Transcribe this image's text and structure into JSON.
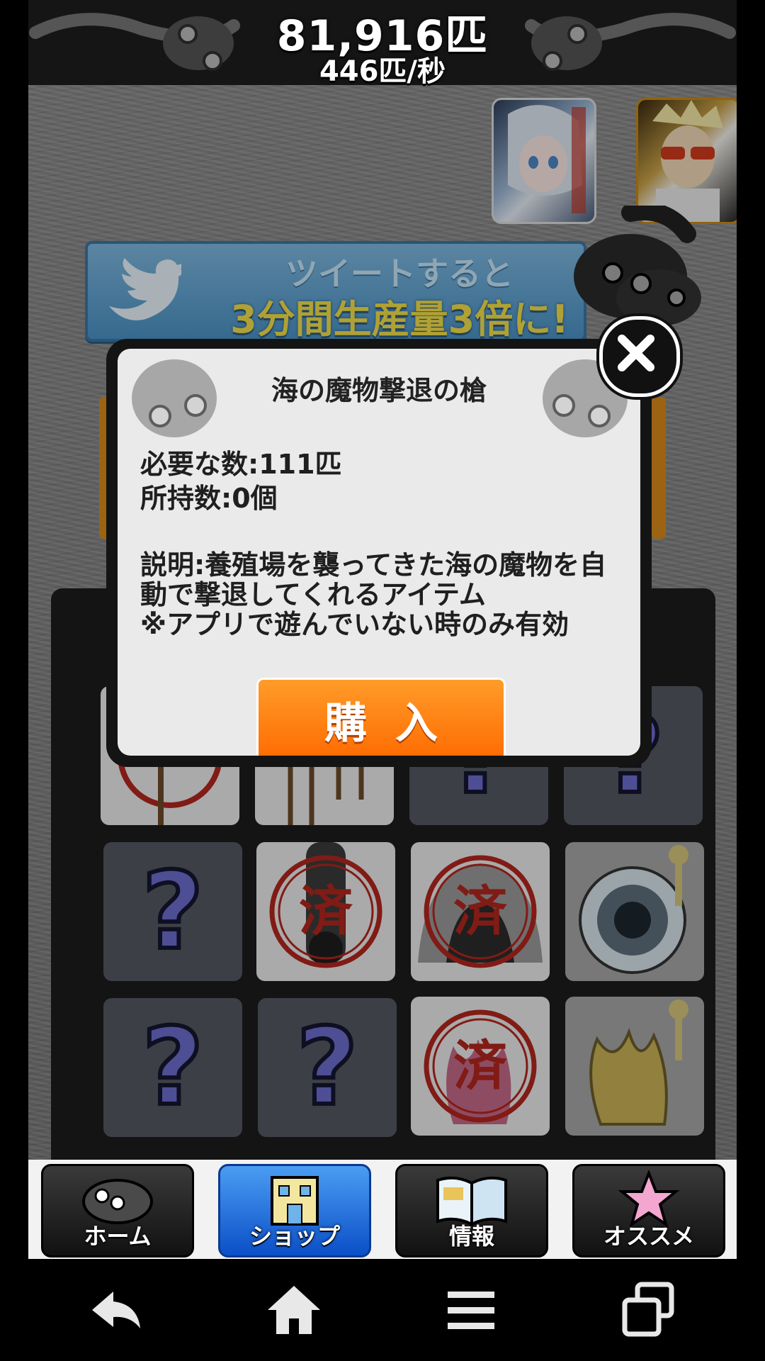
{
  "header": {
    "total_count": "81,916匹",
    "per_second": "446匹/秒"
  },
  "ads": [
    {
      "icon": "anime-girl-game-icon"
    },
    {
      "icon": "sunglasses-man-game-icon"
    }
  ],
  "tweet_banner": {
    "line1": "ツイートすると",
    "line2": "3分間生産量3倍に!",
    "icon": "twitter-bird-icon"
  },
  "popup": {
    "title": "海の魔物撃退の槍",
    "required": "必要な数:111匹",
    "owned": "所持数:0個",
    "description": "説明:養殖場を襲ってきた海の魔物を自\n動で撃退してくれるアイテム\n※アプリで遊んでいない時のみ有効",
    "buy_label": "購入",
    "close_icon": "close-icon"
  },
  "grid": {
    "question_mark": "?",
    "stamp_text": "済"
  },
  "tabs": [
    {
      "label": "ホーム",
      "icon": "catfish-icon",
      "active": false
    },
    {
      "label": "ショップ",
      "icon": "shop-building-icon",
      "active": true
    },
    {
      "label": "情報",
      "icon": "book-icon",
      "active": false
    },
    {
      "label": "オススメ",
      "icon": "starfish-icon",
      "active": false
    }
  ],
  "colors": {
    "accent_orange": "#ff7a0a",
    "active_tab": "#1f6fe0",
    "tweet_blue": "#5aa2d3",
    "tweet_yellow": "#f3e04a"
  }
}
